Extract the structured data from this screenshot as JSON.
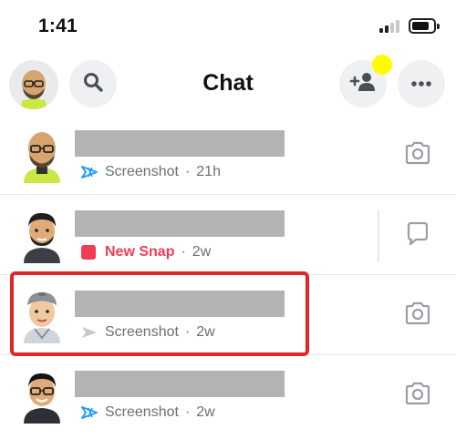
{
  "status_bar": {
    "time": "1:41"
  },
  "header": {
    "title": "Chat"
  },
  "colors": {
    "brand_yellow": "#fffc00",
    "new_snap_red": "#f23c57",
    "screenshot_blue": "#1e9cff",
    "highlight_red": "#e0242c"
  },
  "chats": [
    {
      "status_icon": "screenshot-blue-icon",
      "status": "Screenshot",
      "time": "21h",
      "action_icon": "camera-icon"
    },
    {
      "status_icon": "new-snap-icon",
      "status": "New Snap",
      "time": "2w",
      "action_icon": "chat-bubble-icon"
    },
    {
      "status_icon": "sent-opened-icon",
      "status": "Screenshot",
      "time": "2w",
      "action_icon": "camera-icon"
    },
    {
      "status_icon": "screenshot-blue-icon",
      "status": "Screenshot",
      "time": "2w",
      "action_icon": "camera-icon"
    }
  ],
  "separator": "·"
}
